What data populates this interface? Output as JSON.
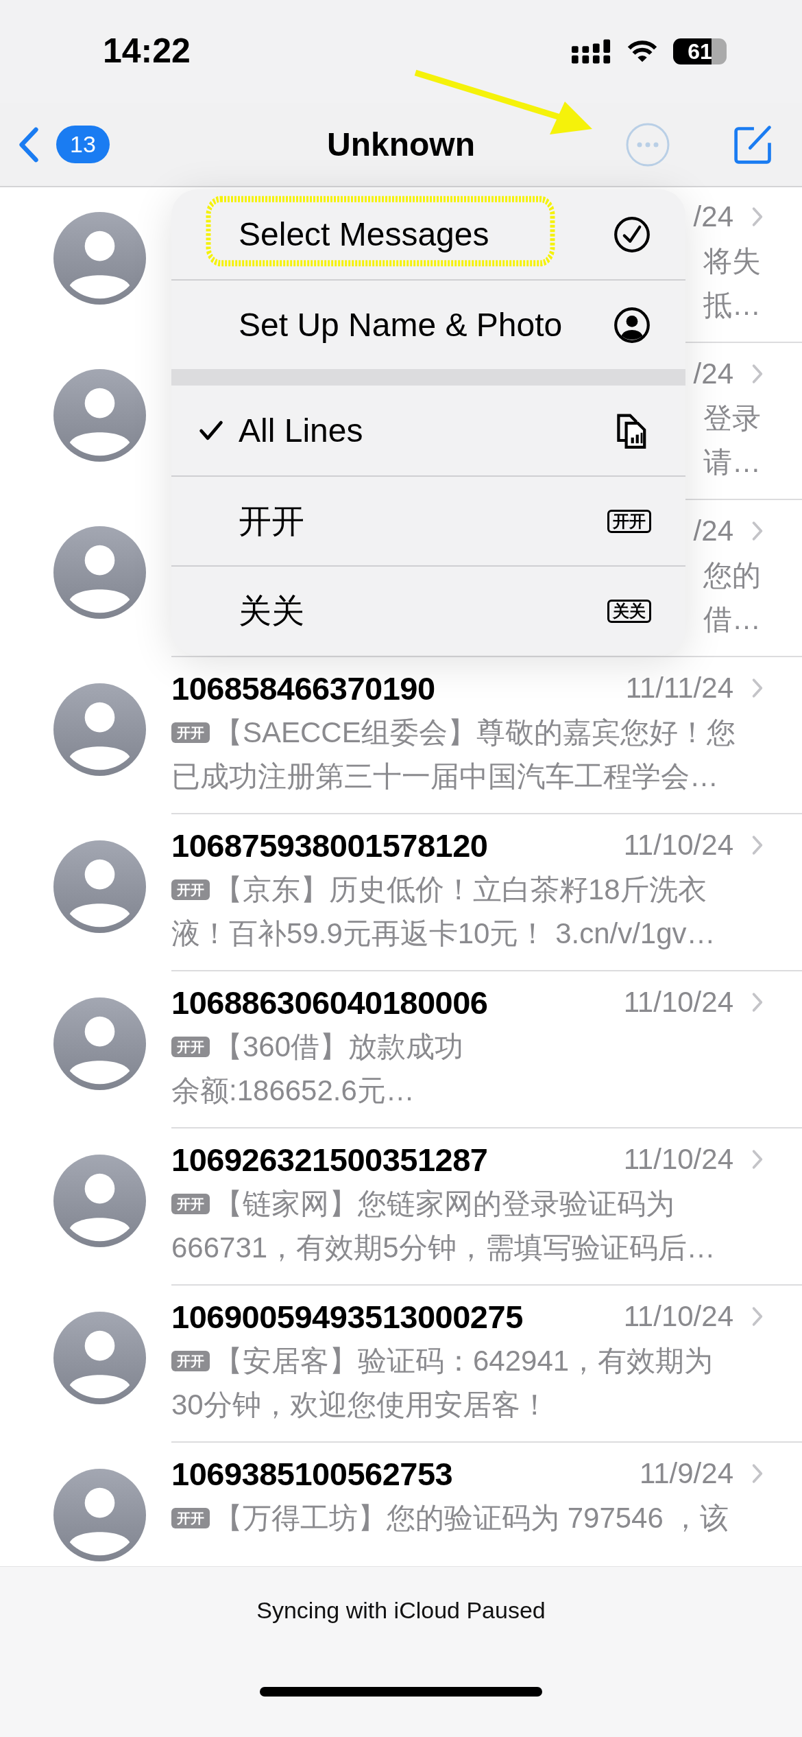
{
  "status_bar": {
    "time": "14:22",
    "battery": "61"
  },
  "nav": {
    "back_count": "13",
    "title": "Unknown"
  },
  "conversations": [
    {
      "kind": "covered",
      "date": "/24",
      "preview_lines": [
        "将失",
        "抵…"
      ]
    },
    {
      "kind": "covered",
      "date": "/24",
      "preview_lines": [
        "登录",
        "请…"
      ]
    },
    {
      "kind": "covered",
      "date": "/24",
      "preview_lines": [
        "您的",
        "借…"
      ]
    },
    {
      "kind": "full",
      "sender": "106858466370190",
      "date": "11/11/24",
      "line_tag": "开开",
      "preview_lines": [
        "【SAECCE组委会】尊敬的嘉宾您好！您",
        "已成功注册第三十一届中国汽车工程学会…"
      ]
    },
    {
      "kind": "full",
      "sender": "106875938001578120",
      "date": "11/10/24",
      "line_tag": "开开",
      "preview_lines": [
        "【京东】历史低价！立白茶籽18斤洗衣",
        "液！百补59.9元再返卡10元！ 3.cn/v/1gv…"
      ]
    },
    {
      "kind": "full",
      "sender": "106886306040180006",
      "date": "11/10/24",
      "line_tag": "开开",
      "preview_lines": [
        "【360借】放款成功",
        "余额:186652.6元…"
      ]
    },
    {
      "kind": "full",
      "sender": "106926321500351287",
      "date": "11/10/24",
      "line_tag": "开开",
      "preview_lines": [
        "【链家网】您链家网的登录验证码为",
        "666731，有效期5分钟，需填写验证码后…"
      ]
    },
    {
      "kind": "full",
      "sender": "10690059493513000275",
      "date": "11/10/24",
      "line_tag": "开开",
      "preview_lines": [
        "【安居客】验证码：642941，有效期为",
        "30分钟，欢迎您使用安居客！"
      ]
    },
    {
      "kind": "full",
      "sender": "1069385100562753",
      "date": "11/9/24",
      "line_tag": "开开",
      "preview_lines": [
        "【万得工坊】您的验证码为 797546 ，该"
      ]
    }
  ],
  "menu": {
    "sections": [
      [
        {
          "kind": "select",
          "label": "Select Messages"
        },
        {
          "kind": "profile",
          "label": "Set Up Name & Photo"
        }
      ],
      [
        {
          "kind": "line",
          "label": "All Lines",
          "selected": true
        },
        {
          "kind": "line",
          "label": "开开",
          "selected": false,
          "tag": "开开"
        },
        {
          "kind": "line",
          "label": "关关",
          "selected": false,
          "tag": "关关"
        }
      ]
    ]
  },
  "toolbar": {
    "text": "Syncing with iCloud Paused"
  }
}
